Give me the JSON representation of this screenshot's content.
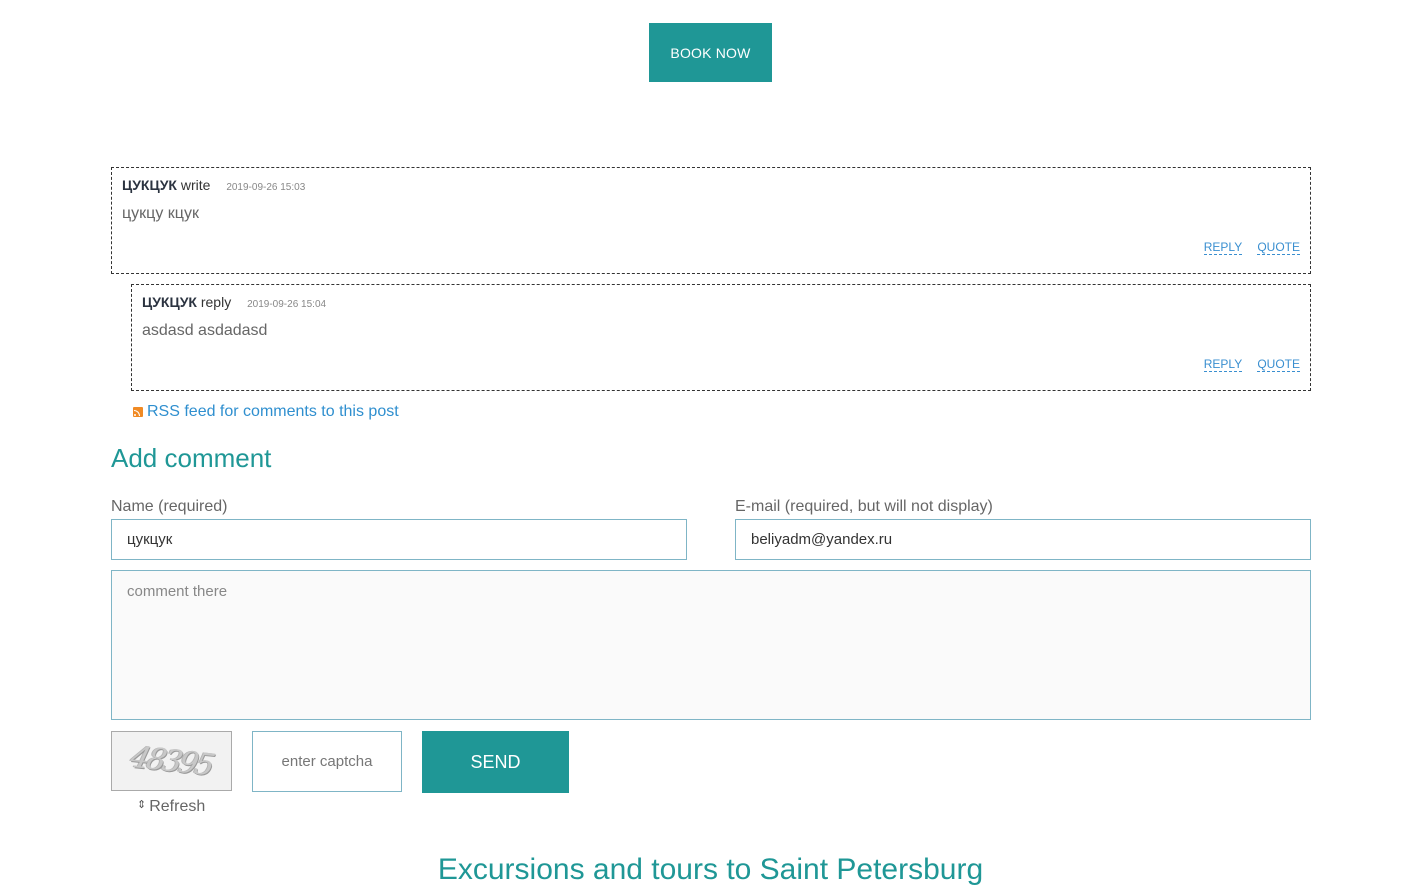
{
  "book_button": {
    "label": "BOOK NOW"
  },
  "comments": [
    {
      "author": "ЦУКЦУК",
      "verb": "write",
      "date": "2019-09-26 15:03",
      "body": "цукцу кцук",
      "reply_label": "REPLY",
      "quote_label": "QUOTE"
    },
    {
      "author": "ЦУКЦУК",
      "verb": "reply",
      "date": "2019-09-26 15:04",
      "body": "asdasd asdadasd",
      "reply_label": "REPLY",
      "quote_label": "QUOTE"
    }
  ],
  "rss": {
    "label": "RSS feed for comments to this post",
    "icon": "rss-icon"
  },
  "form": {
    "title": "Add comment",
    "name_label": "Name (required)",
    "name_value": "цукцук",
    "email_label": "E-mail (required, but will not display)",
    "email_value": "beliyadm@yandex.ru",
    "comment_placeholder": "comment there",
    "captcha_code": "48395",
    "captcha_placeholder": "enter captcha",
    "send_label": "SEND",
    "refresh_label": "Refresh",
    "refresh_icon": "refresh-icon"
  },
  "footer": {
    "title": "Excursions and tours to Saint Petersburg"
  },
  "colors": {
    "accent": "#1f9796",
    "link": "#2f8fcf",
    "field_border": "#7fb5c6"
  }
}
